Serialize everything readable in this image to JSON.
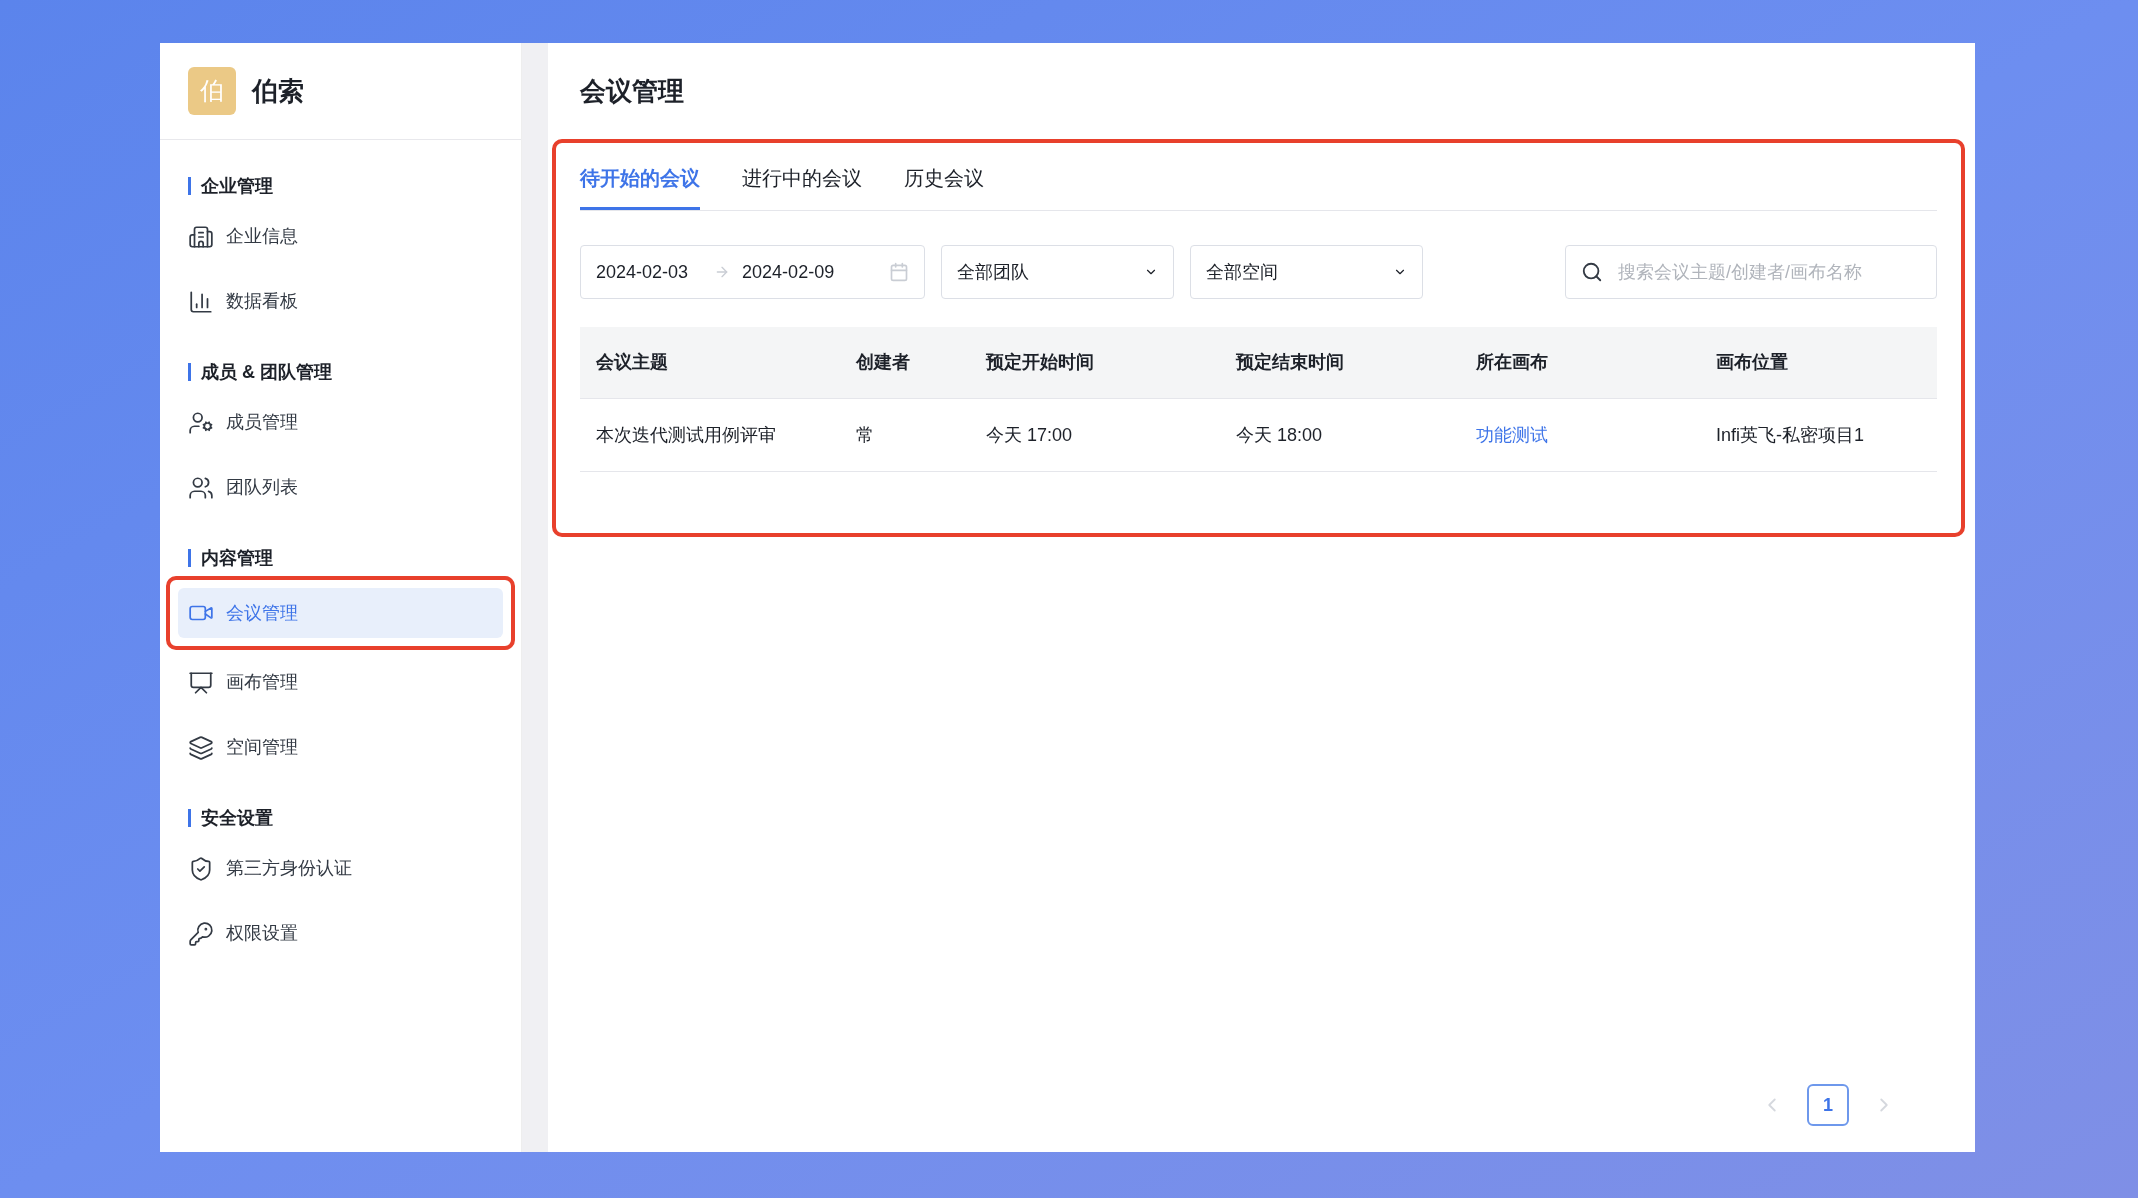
{
  "brand": {
    "mark": "伯",
    "name": "伯索"
  },
  "sidebar": {
    "sections": [
      {
        "title": "企业管理",
        "items": [
          {
            "label": "企业信息",
            "selected": false,
            "highlighted": false
          },
          {
            "label": "数据看板",
            "selected": false,
            "highlighted": false
          }
        ]
      },
      {
        "title": "成员 & 团队管理",
        "items": [
          {
            "label": "成员管理",
            "selected": false,
            "highlighted": false
          },
          {
            "label": "团队列表",
            "selected": false,
            "highlighted": false
          }
        ]
      },
      {
        "title": "内容管理",
        "items": [
          {
            "label": "会议管理",
            "selected": true,
            "highlighted": true
          },
          {
            "label": "画布管理",
            "selected": false,
            "highlighted": false
          },
          {
            "label": "空间管理",
            "selected": false,
            "highlighted": false
          }
        ]
      },
      {
        "title": "安全设置",
        "items": [
          {
            "label": "第三方身份认证",
            "selected": false,
            "highlighted": false
          },
          {
            "label": "权限设置",
            "selected": false,
            "highlighted": false
          }
        ]
      }
    ]
  },
  "page_title": "会议管理",
  "meeting_panel": {
    "highlighted": true,
    "tabs": [
      {
        "label": "待开始的会议",
        "selected": true
      },
      {
        "label": "进行中的会议",
        "selected": false
      },
      {
        "label": "历史会议",
        "selected": false
      }
    ],
    "date_range": {
      "start": "2024-02-03",
      "end": "2024-02-09"
    },
    "team_select": "全部团队",
    "space_select": "全部空间",
    "search": {
      "placeholder": "搜索会议主题/创建者/画布名称"
    },
    "table": {
      "columns": [
        "会议主题",
        "创建者",
        "预定开始时间",
        "预定结束时间",
        "所在画布",
        "画布位置"
      ],
      "rows": [
        [
          {
            "text": "本次迭代测试用例评审",
            "kind": "text"
          },
          {
            "text": "常",
            "kind": "text"
          },
          {
            "text": "今天 17:00",
            "kind": "text"
          },
          {
            "text": "今天 18:00",
            "kind": "text"
          },
          {
            "text": "功能测试",
            "kind": "link"
          },
          {
            "text": "Infi英飞-私密项目1",
            "kind": "text"
          }
        ]
      ]
    }
  },
  "pagination": {
    "prev_disabled": true,
    "next_disabled": true,
    "pages": [
      {
        "label": "1",
        "selected": true
      }
    ]
  }
}
